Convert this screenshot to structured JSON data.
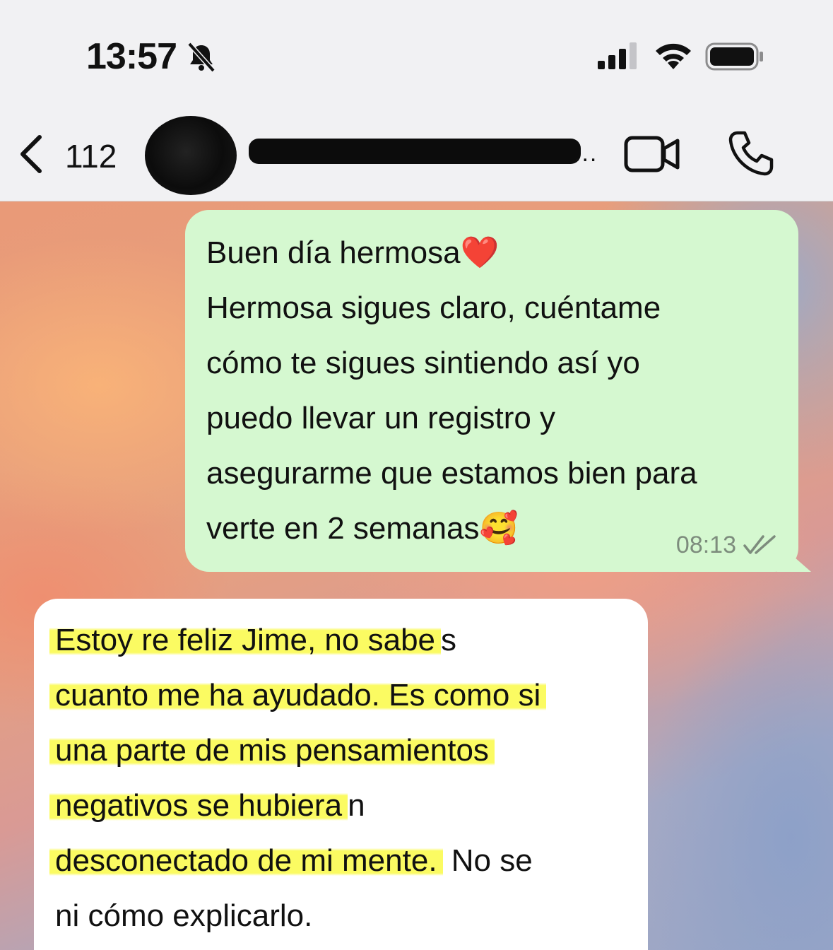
{
  "status_bar": {
    "time": "13:57",
    "icons": [
      "bell-slash-icon",
      "cellular-signal-icon",
      "wifi-icon",
      "battery-icon"
    ]
  },
  "header": {
    "back_count": "112",
    "contact_name_redacted": true,
    "name_ellipsis": "...",
    "actions": [
      "video-call-icon",
      "phone-icon"
    ]
  },
  "messages": [
    {
      "direction": "outgoing",
      "lines": [
        "Buen día hermosa❤️",
        "Hermosa sigues claro, cuéntame",
        "cómo te sigues sintiendo así yo",
        "puedo llevar un registro y",
        "asegurarme que estamos bien para",
        "verte en 2 semanas🥰"
      ],
      "time": "08:13",
      "status": "double-check-icon"
    },
    {
      "direction": "incoming",
      "lines": [
        {
          "highlighted": "Estoy re feliz Jime, no sabe",
          "plain": "s"
        },
        {
          "highlighted": "cuanto me ha ayudado. Es como si",
          "plain": ""
        },
        {
          "highlighted": "una parte de mis pensamientos",
          "plain": ""
        },
        {
          "highlighted": "negativos se hubiera",
          "plain": "n"
        },
        {
          "highlighted": "desconectado de mi mente.",
          "plain": " No se"
        },
        {
          "highlighted": "",
          "plain": "ni cómo explicarlo."
        }
      ]
    }
  ],
  "colors": {
    "outgoing_bubble": "#d5f8d0",
    "incoming_bubble": "#ffffff",
    "highlight": "#fafa46"
  }
}
